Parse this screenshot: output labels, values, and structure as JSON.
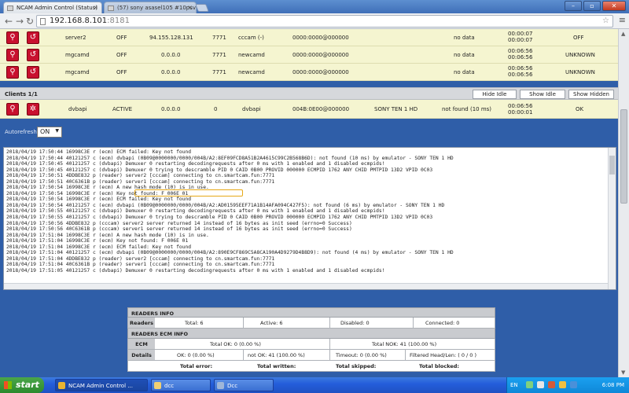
{
  "browser": {
    "tabs": [
      {
        "label": "NCAM Admin Control (Status)"
      },
      {
        "label": "(57) sony asasel105 #10psv"
      }
    ],
    "url_host": "192.168.8.101",
    "url_port": ":8181",
    "window_buttons": {
      "minimize": "–",
      "maximize": "▫",
      "close": "✕"
    }
  },
  "servers": [
    {
      "name": "server2",
      "status": "OFF",
      "ip": "94.155.128.131",
      "port": "7771",
      "protocol": "cccam (-)",
      "caid": "0000:0000@000000",
      "info": "no data",
      "time1": "00:00:07",
      "time2": "00:00:07",
      "state": "OFF"
    },
    {
      "name": "mgcamd",
      "status": "OFF",
      "ip": "0.0.0.0",
      "port": "7771",
      "protocol": "newcamd",
      "caid": "0000:0000@000000",
      "info": "no data",
      "time1": "00:06:56",
      "time2": "00:06:56",
      "state": "UNKNOWN"
    },
    {
      "name": "mgcamd",
      "status": "OFF",
      "ip": "0.0.0.0",
      "port": "7771",
      "protocol": "newcamd",
      "caid": "0000:0000@000000",
      "info": "no data",
      "time1": "00:06:56",
      "time2": "00:06:56",
      "state": "UNKNOWN"
    }
  ],
  "clients": {
    "title": "Clients 1/1",
    "buttons": {
      "hide_idle": "Hide Idle",
      "show_idle": "Show Idle",
      "show_hidden": "Show Hidden"
    },
    "row": {
      "name": "dvbapi",
      "status": "ACTIVE",
      "ip": "0.0.0.0",
      "port": "0",
      "protocol": "dvbapi",
      "caid": "004B:0E00@000000",
      "channel": "SONY TEN 1 HD",
      "info": "not found (10 ms)",
      "time1": "00:06:56",
      "time2": "00:00:01",
      "state": "OK"
    }
  },
  "autorefresh": {
    "label": "Autorefresh:",
    "value": "ON"
  },
  "log": [
    "2018/04/19 17:50:44 16998C3E r (ecm) ECM failed: Key not found",
    "2018/04/19 17:50:44 40121257 c (ecm) dvbapi (0B09@0000000/0000/004B/A2:8EF09FCD8A51B2A4615C99C2B568B6D): not found (10 ms) by emulator - SONY TEN 1 HD",
    "2018/04/19 17:50:45 40121257 c (dvbapi) Demuxer 0 restarting decodingrequests after 0 ms with 1 enabled and 1 disabled ecmpids!",
    "2018/04/19 17:50:45 40121257 c (dvbapi) Demuxer 0 trying to descramble PID 0 CAID 0B00 PROVID 000000 ECMPID 1762 ANY CHID PMTPID 13D2 VPID 0C03",
    "2018/04/19 17:50:51 4DDBE832 p (reader) server2 [cccam] connecting to cn.smartcam.fun:7771",
    "2018/04/19 17:50:51 40C6361B p (reader) server1 [cccam] connecting to cn.smartcam.fun:7771",
    "2018/04/19 17:50:54 16998C3E r (ecm) A new hash mode (10) is in use.",
    "2018/04/19 17:50:54 16998C3E r (ecm) Key not found: F 006E 01",
    "2018/04/19 17:50:54 16998C3E r (ecm) ECM failed: Key not found",
    "2018/04/19 17:50:54 40121257 c (ecm) dvbapi (0B09@0000000/0000/004B/A2:AD01595EEF71A1B14AFA094C427F5): not found (6 ms) by emulator - SONY TEN 1 HD",
    "2018/04/19 17:50:55 40121257 c (dvbapi) Demuxer 0 restarting decodingrequests after 0 ms with 1 enabled and 1 disabled ecmpids!",
    "2018/04/19 17:50:55 40121257 c (dvbapi) Demuxer 0 trying to descramble PID 0 CAID 0B00 PROVID 000000 ECMPID 1762 ANY CHID PMTPID 13D2 VPID 0C03",
    "2018/04/19 17:50:56 4DDBE832 p (cccam) server2 server returned 14 instead of 16 bytes as init seed (errno=0 Success)",
    "2018/04/19 17:50:56 40C6361B p (cccam) server1 server returned 14 instead of 16 bytes as init seed (errno=0 Success)",
    "2018/04/19 17:51:04 16998C3E r (ecm) A new hash mode (10) is in use.",
    "2018/04/19 17:51:04 16998C3E r (ecm) Key not found: F 006E 01",
    "2018/04/19 17:51:04 16998C3E r (ecm) ECM failed: Key not found",
    "2018/04/19 17:51:04 40121257 c (ecm) dvbapi (0B09@0000000/0000/004B/A2:890E9CF869C5A8CA190A4D9279D4B8D9): not found (4 ms) by emulator - SONY TEN 1 HD",
    "2018/04/19 17:51:04 4DDBE832 p (reader) server2 [cccam] connecting to cn.smartcam.fun:7771",
    "2018/04/19 17:51:04 40C6361B p (reader) server1 [cccam] connecting to cn.smartcam.fun:7771",
    "2018/04/19 17:51:05 40121257 c (dvbapi) Demuxer 0 restarting decodingrequests after 0 ms with 1 enabled and 1 disabled ecmpids!"
  ],
  "readers_info": {
    "title": "READERS INFO",
    "row_label": "Readers",
    "total": "Total: 6",
    "active": "Active: 6",
    "disabled": "Disabled: 0",
    "connected": "Connected: 0"
  },
  "readers_ecm": {
    "title": "READERS ECM INFO",
    "ecm_label": "ECM",
    "total_ok": "Total OK: 0 (0.00 %)",
    "total_nok": "Total NOK: 41 (100.00 %)",
    "details_label": "Details",
    "ok": "OK: 0 (0.00 %)",
    "not_ok": "not OK: 41 (100.00 %)",
    "timeout": "Timeout: 0 (0.00 %)",
    "filtered": "Filtered Head/Len: ( 0 / 0 )",
    "total_error": "Total error:",
    "total_written": "Total written:",
    "total_skipped": "Total skipped:",
    "total_blocked": "Total blocked:"
  },
  "taskbar": {
    "start": "start",
    "tasks": [
      "NCAM Admin Control ...",
      "dcc",
      "Dcc"
    ],
    "lang": "EN",
    "clock": "6:08 PM"
  }
}
